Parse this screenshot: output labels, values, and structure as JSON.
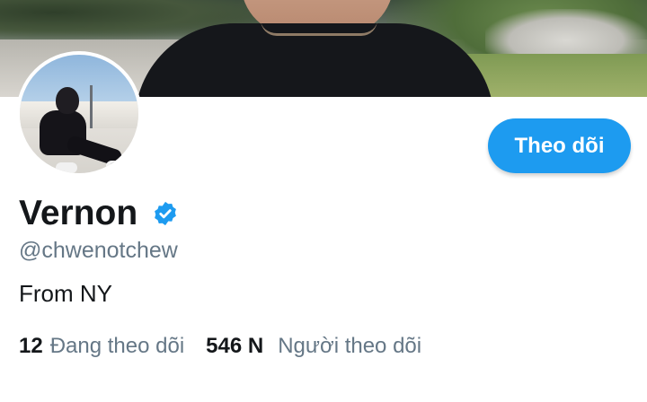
{
  "profile": {
    "display_name": "Vernon",
    "handle": "@chwenotchew",
    "bio": "From NY",
    "verified": true,
    "follow_button_label": "Theo dõi"
  },
  "stats": {
    "following_count": "12",
    "following_label": "Đang theo dõi",
    "followers_count": "546 N",
    "followers_label": "Người theo dõi"
  },
  "colors": {
    "accent": "#1d9bf0",
    "secondary_text": "#657786",
    "primary_text": "#14171a"
  },
  "icons": {
    "verified": "verified-badge-icon"
  }
}
